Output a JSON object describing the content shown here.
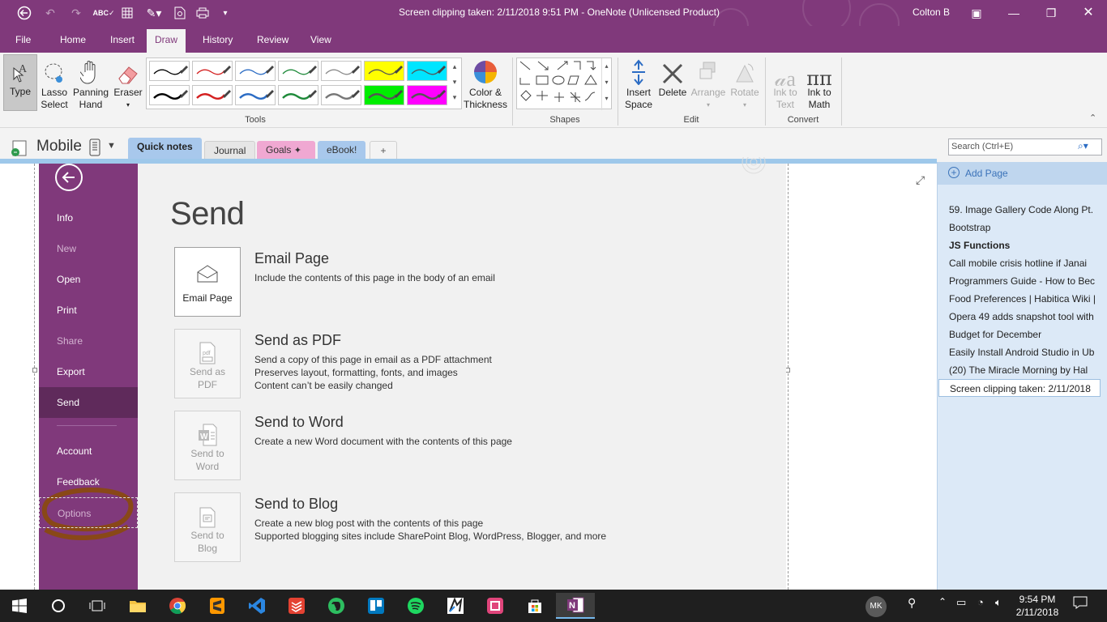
{
  "titlebar": {
    "title": "Screen clipping taken: 2/11/2018 9:51 PM  -  OneNote (Unlicensed Product)",
    "user": "Colton B"
  },
  "ribbon_tabs": [
    "File",
    "Home",
    "Insert",
    "Draw",
    "History",
    "Review",
    "View"
  ],
  "active_tab": "Draw",
  "tools": {
    "type": "Type",
    "lasso": "Lasso Select",
    "lasso_line1": "Lasso",
    "lasso_line2": "Select",
    "panning_line1": "Panning",
    "panning_line2": "Hand",
    "eraser": "Eraser",
    "color_line1": "Color &",
    "color_line2": "Thickness",
    "group_label": "Tools"
  },
  "pens": [
    {
      "color": "#000000"
    },
    {
      "color": "#d42020"
    },
    {
      "color": "#2b6cc4"
    },
    {
      "color": "#1e8a3a"
    },
    {
      "color": "#8a8a8a"
    },
    {
      "color": "#ffff00",
      "highlighter": true
    },
    {
      "color": "#00e5ff",
      "highlighter": true
    },
    {
      "color": "#000000"
    },
    {
      "color": "#d42020"
    },
    {
      "color": "#2b6cc4"
    },
    {
      "color": "#1e8a3a"
    },
    {
      "color": "#777777"
    },
    {
      "color": "#00ee00",
      "highlighter": true
    },
    {
      "color": "#ff00ff",
      "highlighter": true
    }
  ],
  "shapes": {
    "group_label": "Shapes"
  },
  "edit": {
    "insert_line1": "Insert",
    "insert_line2": "Space",
    "delete": "Delete",
    "arrange": "Arrange",
    "rotate": "Rotate",
    "group_label": "Edit"
  },
  "convert": {
    "ink_text_line1": "Ink to",
    "ink_text_line2": "Text",
    "ink_math_line1": "Ink to",
    "ink_math_line2": "Math",
    "group_label": "Convert"
  },
  "notebook": {
    "name": "Mobile",
    "sections": [
      {
        "label": "Quick notes",
        "color": "#a8c8ec",
        "active": true
      },
      {
        "label": "Journal",
        "color": "#e6e6e6"
      },
      {
        "label": "Goals",
        "color": "#f0a8d2"
      },
      {
        "label": "eBook!",
        "color": "#a8c8ec"
      }
    ],
    "add_section": "+",
    "search_placeholder": "Search (Ctrl+E)"
  },
  "backstage": {
    "nav": [
      {
        "label": "Info",
        "state": "normal"
      },
      {
        "label": "New",
        "state": "dim"
      },
      {
        "label": "Open",
        "state": "normal"
      },
      {
        "label": "Print",
        "state": "normal"
      },
      {
        "label": "Share",
        "state": "dim"
      },
      {
        "label": "Export",
        "state": "normal"
      },
      {
        "label": "Send",
        "state": "selected"
      },
      {
        "label": "Account",
        "state": "normal"
      },
      {
        "label": "Feedback",
        "state": "normal"
      },
      {
        "label": "Options",
        "state": "dim"
      }
    ],
    "heading": "Send",
    "options": [
      {
        "tile_line1": "Email Page",
        "tile_line2": "",
        "title": "Email Page",
        "desc": [
          "Include the contents of this page in the body of an email"
        ],
        "enabled": true
      },
      {
        "tile_line1": "Send as",
        "tile_line2": "PDF",
        "title": "Send as PDF",
        "desc": [
          "Send a copy of this page in email as a PDF attachment",
          "Preserves layout, formatting, fonts, and images",
          "Content can’t be easily changed"
        ],
        "enabled": false
      },
      {
        "tile_line1": "Send to",
        "tile_line2": "Word",
        "title": "Send to Word",
        "desc": [
          "Create a new Word document with the contents of this page"
        ],
        "enabled": false
      },
      {
        "tile_line1": "Send to",
        "tile_line2": "Blog",
        "title": "Send to Blog",
        "desc": [
          "Create a new blog post with the contents of this page",
          "Supported blogging sites include SharePoint Blog, WordPress, Blogger, and more"
        ],
        "enabled": false
      }
    ]
  },
  "pagelist": {
    "add_page": "Add Page",
    "pages": [
      {
        "label": "59. Image Gallery Code Along Pt.",
        "style": "normal"
      },
      {
        "label": "Bootstrap",
        "style": "normal"
      },
      {
        "label": "JS Functions",
        "style": "bold"
      },
      {
        "label": "Call mobile crisis hotline if Janai",
        "style": "normal"
      },
      {
        "label": "Programmers Guide - How to Bec",
        "style": "normal"
      },
      {
        "label": "Food Preferences | Habitica Wiki |",
        "style": "normal"
      },
      {
        "label": "Opera 49 adds snapshot tool with",
        "style": "normal"
      },
      {
        "label": "Budget for December",
        "style": "normal"
      },
      {
        "label": "Easily Install Android Studio in Ub",
        "style": "normal"
      },
      {
        "label": "(20) The Miracle Morning by Hal",
        "style": "normal"
      },
      {
        "label": "Screen clipping taken: 2/11/2018",
        "style": "selected"
      }
    ]
  },
  "taskbar": {
    "avatar": "MK",
    "time": "9:54 PM",
    "date": "2/11/2018"
  }
}
